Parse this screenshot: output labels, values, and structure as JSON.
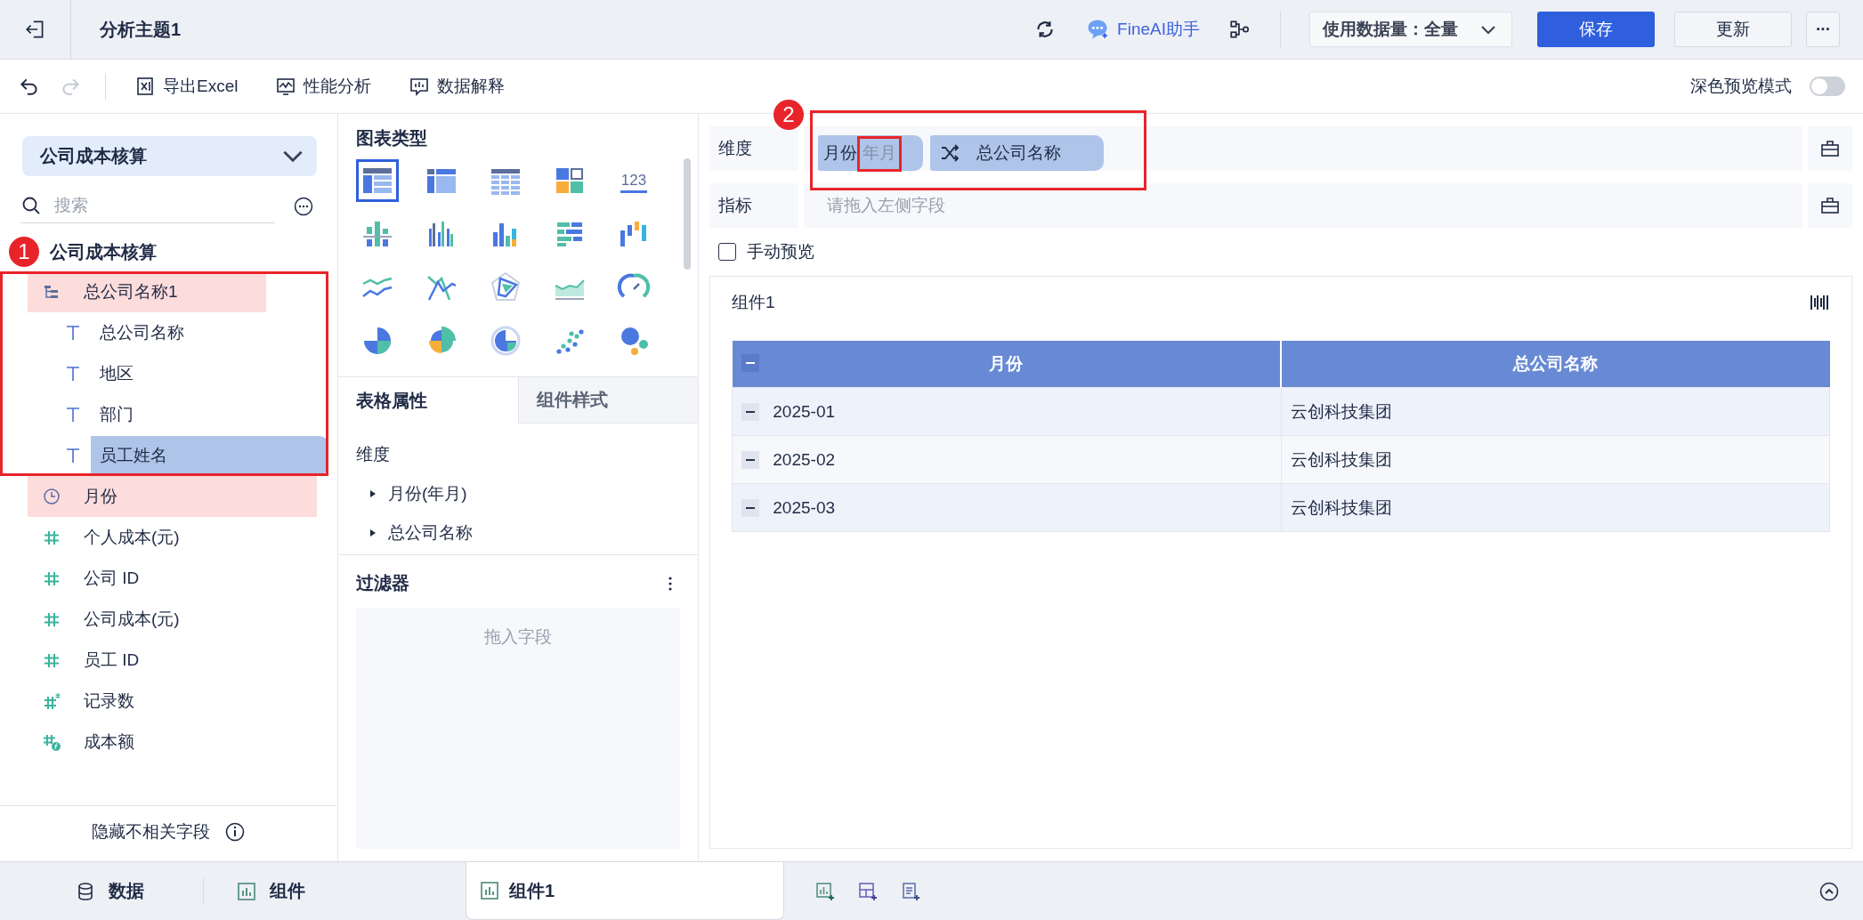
{
  "header": {
    "title": "分析主题1",
    "ai_assistant": "FineAI助手",
    "data_amount": "使用数据量：全量",
    "buttons": [
      {
        "label": "保存",
        "kind": "primary"
      },
      {
        "label": "更新",
        "kind": "secondary"
      },
      {
        "label": "···",
        "kind": "more"
      }
    ]
  },
  "toolbar": {
    "history": [
      {
        "kind": "undo",
        "disabled": false
      },
      {
        "kind": "redo",
        "disabled": true
      }
    ],
    "actions": [
      {
        "kind": "excel",
        "label": "导出Excel"
      },
      {
        "kind": "performance",
        "label": "性能分析"
      },
      {
        "kind": "explain",
        "label": "数据解释"
      }
    ],
    "dark_mode": {
      "label": "深色预览模式",
      "on": false
    }
  },
  "data_panel": {
    "dataset": "公司成本核算",
    "search": {
      "placeholder": "搜索"
    },
    "table_name": "公司成本核算",
    "fields": [
      {
        "name": "总公司名称1",
        "kind": "group",
        "highlighted": true,
        "selected": false,
        "children": [
          {
            "name": "总公司名称",
            "kind": "text",
            "highlighted": false,
            "selected": false
          },
          {
            "name": "地区",
            "kind": "text",
            "highlighted": false,
            "selected": false
          },
          {
            "name": "部门",
            "kind": "text",
            "highlighted": false,
            "selected": false
          },
          {
            "name": "员工姓名",
            "kind": "text",
            "highlighted": false,
            "selected": true
          }
        ]
      },
      {
        "name": "月份",
        "kind": "date",
        "highlighted": true,
        "selected": false
      },
      {
        "name": "个人成本(元)",
        "kind": "number",
        "highlighted": false,
        "selected": false
      },
      {
        "name": "公司 ID",
        "kind": "number",
        "highlighted": false,
        "selected": false
      },
      {
        "name": "公司成本(元)",
        "kind": "number",
        "highlighted": false,
        "selected": false
      },
      {
        "name": "员工 ID",
        "kind": "number",
        "highlighted": false,
        "selected": false
      },
      {
        "name": "记录数",
        "kind": "count",
        "highlighted": false,
        "selected": false
      },
      {
        "name": "成本额",
        "kind": "calc",
        "highlighted": false,
        "selected": false
      }
    ],
    "footer": "隐藏不相关字段"
  },
  "chart_types": {
    "title": "图表类型",
    "items": [
      {
        "kind": "group-table",
        "selected": true
      },
      {
        "kind": "cross-table",
        "selected": false
      },
      {
        "kind": "detail-table",
        "selected": false
      },
      {
        "kind": "blocks",
        "selected": false
      },
      {
        "kind": "number",
        "label": "123",
        "selected": false
      },
      {
        "kind": "diverging-bar",
        "selected": false
      },
      {
        "kind": "multi-bar",
        "selected": false
      },
      {
        "kind": "color-bar",
        "selected": false
      },
      {
        "kind": "horizontal-bar",
        "selected": false
      },
      {
        "kind": "range-bar",
        "selected": false
      },
      {
        "kind": "multi-line",
        "selected": false
      },
      {
        "kind": "cross-line",
        "selected": false
      },
      {
        "kind": "radar",
        "selected": false
      },
      {
        "kind": "area",
        "selected": false
      },
      {
        "kind": "gauge",
        "selected": false
      },
      {
        "kind": "pie",
        "selected": false
      },
      {
        "kind": "rose",
        "selected": false
      },
      {
        "kind": "ring",
        "selected": false
      },
      {
        "kind": "scatter",
        "selected": false
      },
      {
        "kind": "bubble",
        "selected": false
      }
    ]
  },
  "properties": {
    "tabs": [
      {
        "label": "表格属性",
        "selected": true
      },
      {
        "label": "组件样式",
        "selected": false
      }
    ],
    "section": "维度",
    "items": [
      "月份(年月)",
      "总公司名称"
    ]
  },
  "filter": {
    "title": "过滤器",
    "placeholder": "拖入字段"
  },
  "dimensions": {
    "label": "维度",
    "chips": [
      {
        "label": "月份",
        "sub": "年月",
        "kind": "date"
      },
      {
        "label": "总公司名称",
        "kind": "shuffle"
      }
    ]
  },
  "measures": {
    "label": "指标",
    "placeholder": "请拖入左侧字段"
  },
  "manual_preview": {
    "label": "手动预览",
    "checked": false
  },
  "widget": {
    "title": "组件1",
    "table": {
      "columns": [
        "月份",
        "总公司名称"
      ],
      "rows": [
        {
          "cells": [
            "2025-01",
            "云创科技集团"
          ]
        },
        {
          "cells": [
            "2025-02",
            "云创科技集团"
          ]
        },
        {
          "cells": [
            "2025-03",
            "云创科技集团"
          ]
        }
      ]
    }
  },
  "bottom_bar": {
    "tabs": [
      {
        "label": "数据",
        "kind": "data"
      },
      {
        "label": "组件",
        "kind": "widget"
      }
    ],
    "open_tabs": [
      {
        "label": "组件1",
        "selected": true
      }
    ]
  },
  "annotations": [
    {
      "label": "1"
    },
    {
      "label": "2"
    }
  ]
}
